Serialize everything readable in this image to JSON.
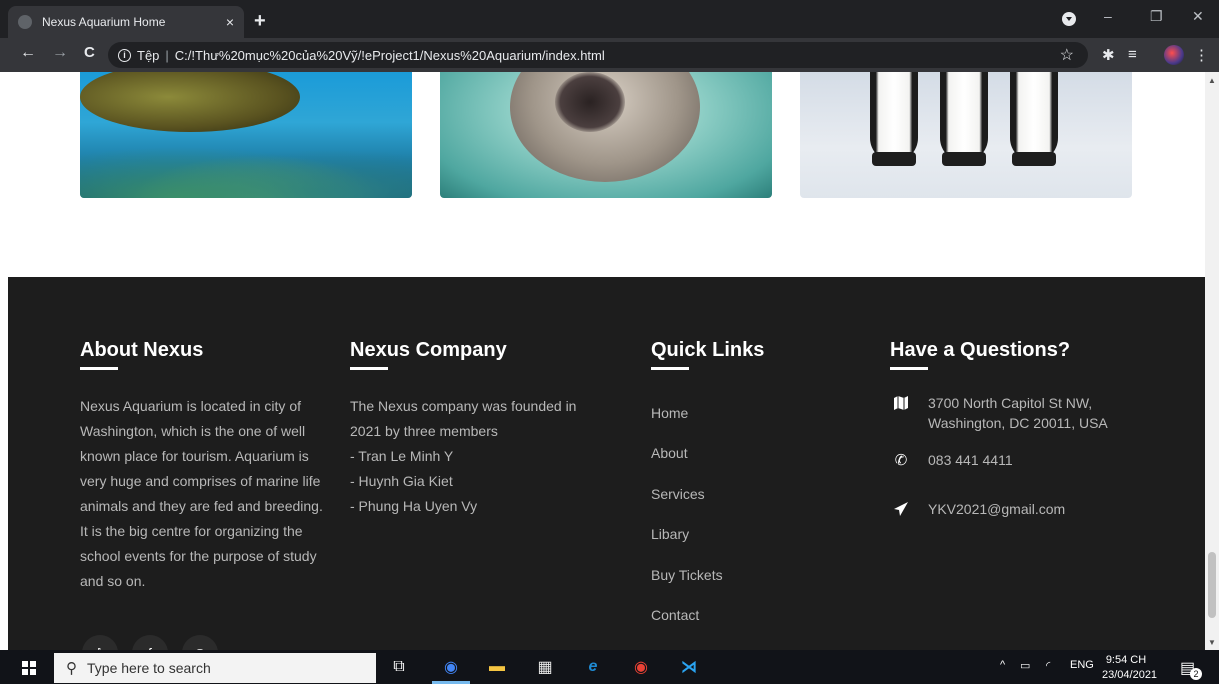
{
  "browser": {
    "tab_title": "Nexus Aquarium Home",
    "tab_close": "×",
    "new_tab": "+",
    "url_scheme": "Tệp",
    "url_sep": "|",
    "url": "C:/!Thư%20mục%20của%20Vỹ/!eProject1/Nexus%20Aquarium/index.html",
    "info": "i",
    "nav": {
      "back": "←",
      "forward": "→",
      "reload": "C"
    },
    "star": "☆",
    "window_controls": {
      "minimize": "–",
      "restore": "❐",
      "close": "✕"
    }
  },
  "footer": {
    "about": {
      "title": "About Nexus",
      "text": "Nexus Aquarium is located in city of Washington, which is the one of well known place for tourism. Aquarium is very huge and comprises of marine life animals and they are fed and breeding. It is the big centre for organizing the school events for the purpose of study and so on."
    },
    "company": {
      "title": "Nexus Company",
      "text": "The Nexus company was founded in 2021 by three members\n- Tran Le Minh Y\n- Huynh Gia Kiet\n- Phung Ha Uyen Vy"
    },
    "quick_links": {
      "title": "Quick Links",
      "items": [
        "Home",
        "About",
        "Services",
        "Libary",
        "Buy Tickets",
        "Contact"
      ]
    },
    "questions": {
      "title": "Have a Questions?",
      "address": "3700 North Capitol St NW,\nWashington, DC 20011, USA",
      "phone": "083 441 4411",
      "email": "YKV2021@gmail.com"
    },
    "social": [
      "twitter-icon",
      "facebook-icon",
      "instagram-icon"
    ]
  },
  "taskbar": {
    "search_placeholder": "Type here to search",
    "language": "ENG",
    "time": "9:54 CH",
    "date": "23/04/2021",
    "notification_count": "2"
  },
  "colors": {
    "footer_bg": "#1d1d1d",
    "footer_text": "#b8b8b8",
    "heading": "#ffffff",
    "chrome_dark": "#202124"
  }
}
